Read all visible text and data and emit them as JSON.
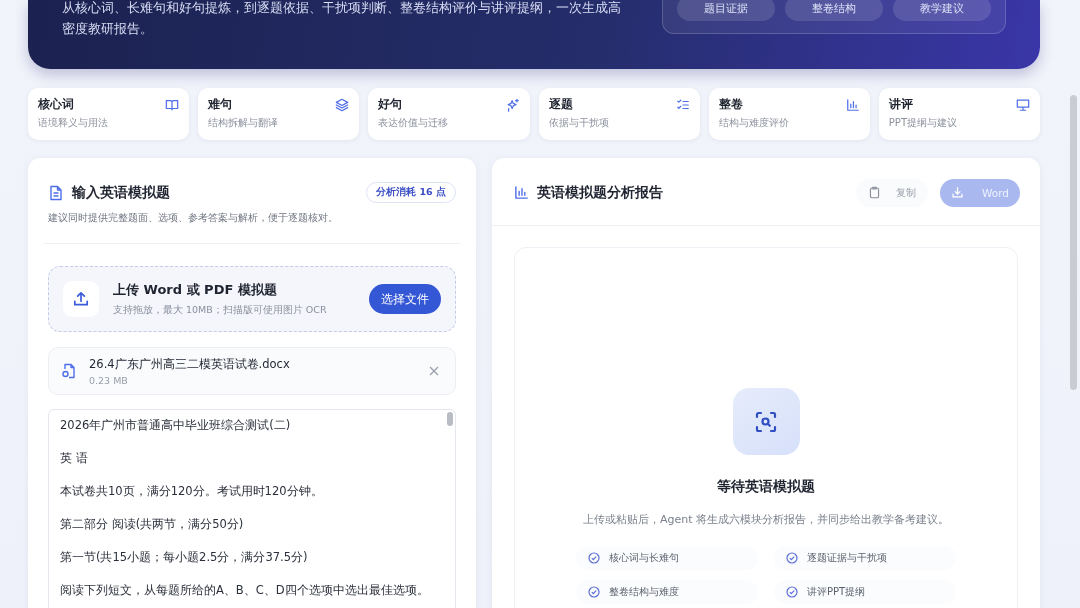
{
  "banner": {
    "description": "从核心词、长难句和好句提炼，到逐题依据、干扰项判断、整卷结构评价与讲评提纲，一次生成高密度教研报告。",
    "tags": [
      "题目证据",
      "整卷结构",
      "教学建议"
    ]
  },
  "modules": [
    {
      "title": "核心词",
      "subtitle": "语境释义与用法"
    },
    {
      "title": "难句",
      "subtitle": "结构拆解与翻译"
    },
    {
      "title": "好句",
      "subtitle": "表达价值与迁移"
    },
    {
      "title": "逐题",
      "subtitle": "依据与干扰项"
    },
    {
      "title": "整卷",
      "subtitle": "结构与难度评价"
    },
    {
      "title": "讲评",
      "subtitle": "PPT提纲与建议"
    }
  ],
  "input_panel": {
    "title": "输入英语模拟题",
    "cost": "分析消耗 16 点",
    "hint": "建议同时提供完整题面、选项、参考答案与解析，便于逐题核对。",
    "upload": {
      "title": "上传 Word 或 PDF 模拟题",
      "subtitle": "支持拖放，最大 10MB；扫描版可使用图片 OCR",
      "button": "选择文件"
    },
    "file": {
      "name": "26.4广东广州高三二模英语试卷.docx",
      "size": "0.23 MB"
    },
    "text_lines": [
      "2026年广州市普通高中毕业班综合测试(二)",
      "英 语",
      "本试卷共10页，满分120分。考试用时120分钟。",
      "第二部分 阅读(共两节，满分50分)",
      "第一节(共15小题；每小题2.5分，满分37.5分)",
      "阅读下列短文，从每题所给的A、B、C、D四个选项中选出最佳选项。"
    ]
  },
  "report_panel": {
    "title": "英语模拟题分析报告",
    "copy_button": {
      "label": "复制",
      "disabled": true
    },
    "download_button": {
      "label": "Word",
      "disabled": true
    },
    "empty_state": {
      "title": "等待英语模拟题",
      "description": "上传或粘贴后，Agent 将生成六模块分析报告，并同步给出教学备考建议。",
      "features": [
        "核心词与长难句",
        "逐题证据与干扰项",
        "整卷结构与难度",
        "讲评PPT提纲"
      ]
    }
  }
}
